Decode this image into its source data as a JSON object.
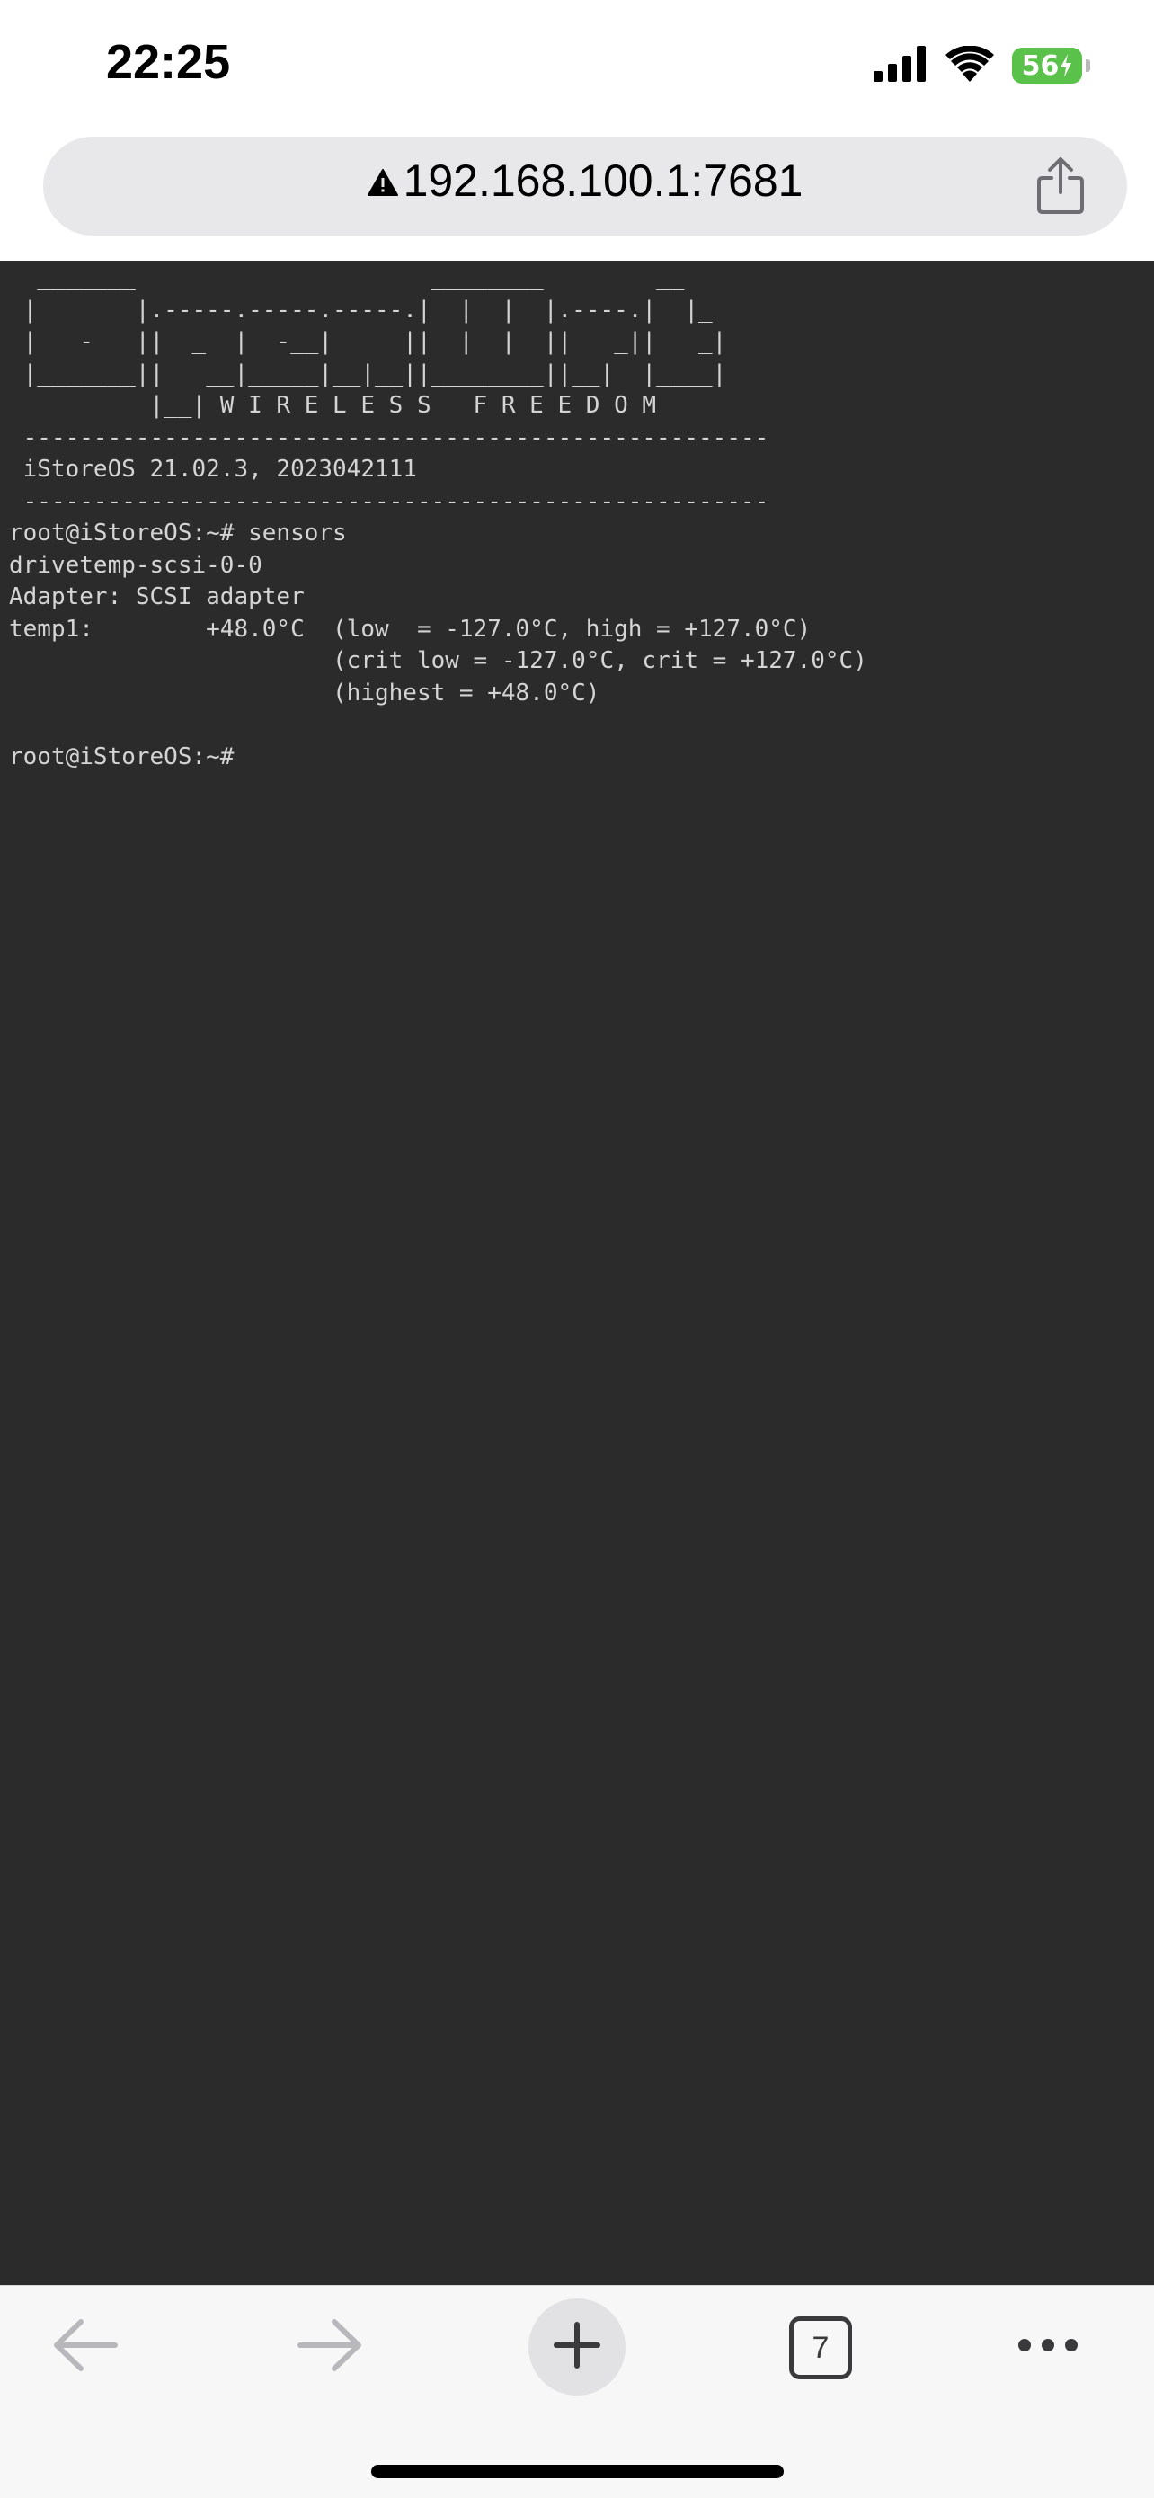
{
  "status_bar": {
    "time": "22:25",
    "battery_level": "56",
    "icons": [
      "cellular-signal-icon",
      "wifi-icon",
      "battery-charging-icon"
    ]
  },
  "browser": {
    "url": "192.168.100.1:7681",
    "url_icon": "insecure-warning-icon",
    "share_icon": "share-icon",
    "open_tab_count": "7",
    "nav_icons": [
      "back-arrow-icon",
      "forward-arrow-icon",
      "new-tab-plus-icon",
      "tabs-icon",
      "more-icon"
    ]
  },
  "terminal": {
    "background": "#2b2b2b",
    "banner_lines": [
      "  _______                     ________        __",
      " |       |.-----.-----.-----.|  |  |  |.----.|  |_",
      " |   -   ||  _  |  -__|     ||  |  |  ||   _||   _|",
      " |_______||   __|_____|__|__||________||__|  |____|",
      "          |__| W I R E L E S S   F R E E D O M",
      " -----------------------------------------------------",
      " iStoreOS 21.02.3, 2023042111",
      " -----------------------------------------------------"
    ],
    "session_lines": [
      "root@iStoreOS:~# sensors",
      "drivetemp-scsi-0-0",
      "Adapter: SCSI adapter",
      "temp1:        +48.0°C  (low  = -127.0°C, high = +127.0°C)",
      "                       (crit low = -127.0°C, crit = +127.0°C)",
      "                       (highest = +48.0°C)",
      "",
      "root@iStoreOS:~#"
    ]
  }
}
